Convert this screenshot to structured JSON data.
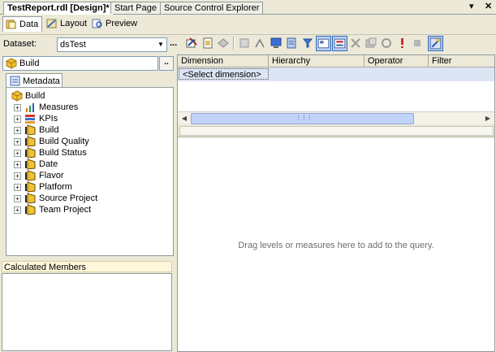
{
  "document_tabs": [
    {
      "label": "TestReport.rdl [Design]*",
      "active": true
    },
    {
      "label": "Start Page",
      "active": false
    },
    {
      "label": "Source Control Explorer",
      "active": false
    }
  ],
  "window_controls": {
    "dropdown_glyph": "▾",
    "close_glyph": "✕"
  },
  "designer_tabs": [
    {
      "label": "Data",
      "icon": "data-icon",
      "active": true
    },
    {
      "label": "Layout",
      "icon": "layout-icon",
      "active": false
    },
    {
      "label": "Preview",
      "icon": "preview-icon",
      "active": false
    }
  ],
  "dataset": {
    "label": "Dataset:",
    "value": "dsTest",
    "ellipsis": "..."
  },
  "toolbar": {
    "icons": [
      "edit-dataset-icon",
      "new-dataset-icon",
      "delete-dataset-icon",
      "refresh-fields-icon",
      "import-icon",
      "command-type-icon",
      "generic-query-designer-icon",
      "run-query-icon",
      "show-empty-cells-icon",
      "show-filter-icon",
      "delete-icon",
      "add-calculated-member-icon",
      "prepare-query-icon",
      "exclamation-icon",
      "cancel-query-icon",
      "design-mode-icon"
    ]
  },
  "cube": {
    "name": "Build",
    "browse_label": ".."
  },
  "metadata_tab": {
    "label": "Metadata"
  },
  "tree": {
    "root": "Build",
    "items": [
      {
        "label": "Measures",
        "icon": "measures-icon"
      },
      {
        "label": "KPIs",
        "icon": "kpis-icon"
      },
      {
        "label": "Build",
        "icon": "dimension-icon"
      },
      {
        "label": "Build Quality",
        "icon": "dimension-icon"
      },
      {
        "label": "Build Status",
        "icon": "dimension-icon"
      },
      {
        "label": "Date",
        "icon": "dimension-icon"
      },
      {
        "label": "Flavor",
        "icon": "dimension-icon"
      },
      {
        "label": "Platform",
        "icon": "dimension-icon"
      },
      {
        "label": "Source Project",
        "icon": "dimension-icon"
      },
      {
        "label": "Team Project",
        "icon": "dimension-icon"
      }
    ]
  },
  "calculated_members": {
    "label": "Calculated Members"
  },
  "filter_grid": {
    "columns": [
      "Dimension",
      "Hierarchy",
      "Operator",
      "Filter Expression"
    ],
    "placeholder_row": "<Select dimension>"
  },
  "scrollbar": {
    "left_arrow": "◀",
    "right_arrow": "▶",
    "grip": "⋮⋮⋮"
  },
  "query_pane": {
    "hint": "Drag levels or measures here to add to the query."
  }
}
